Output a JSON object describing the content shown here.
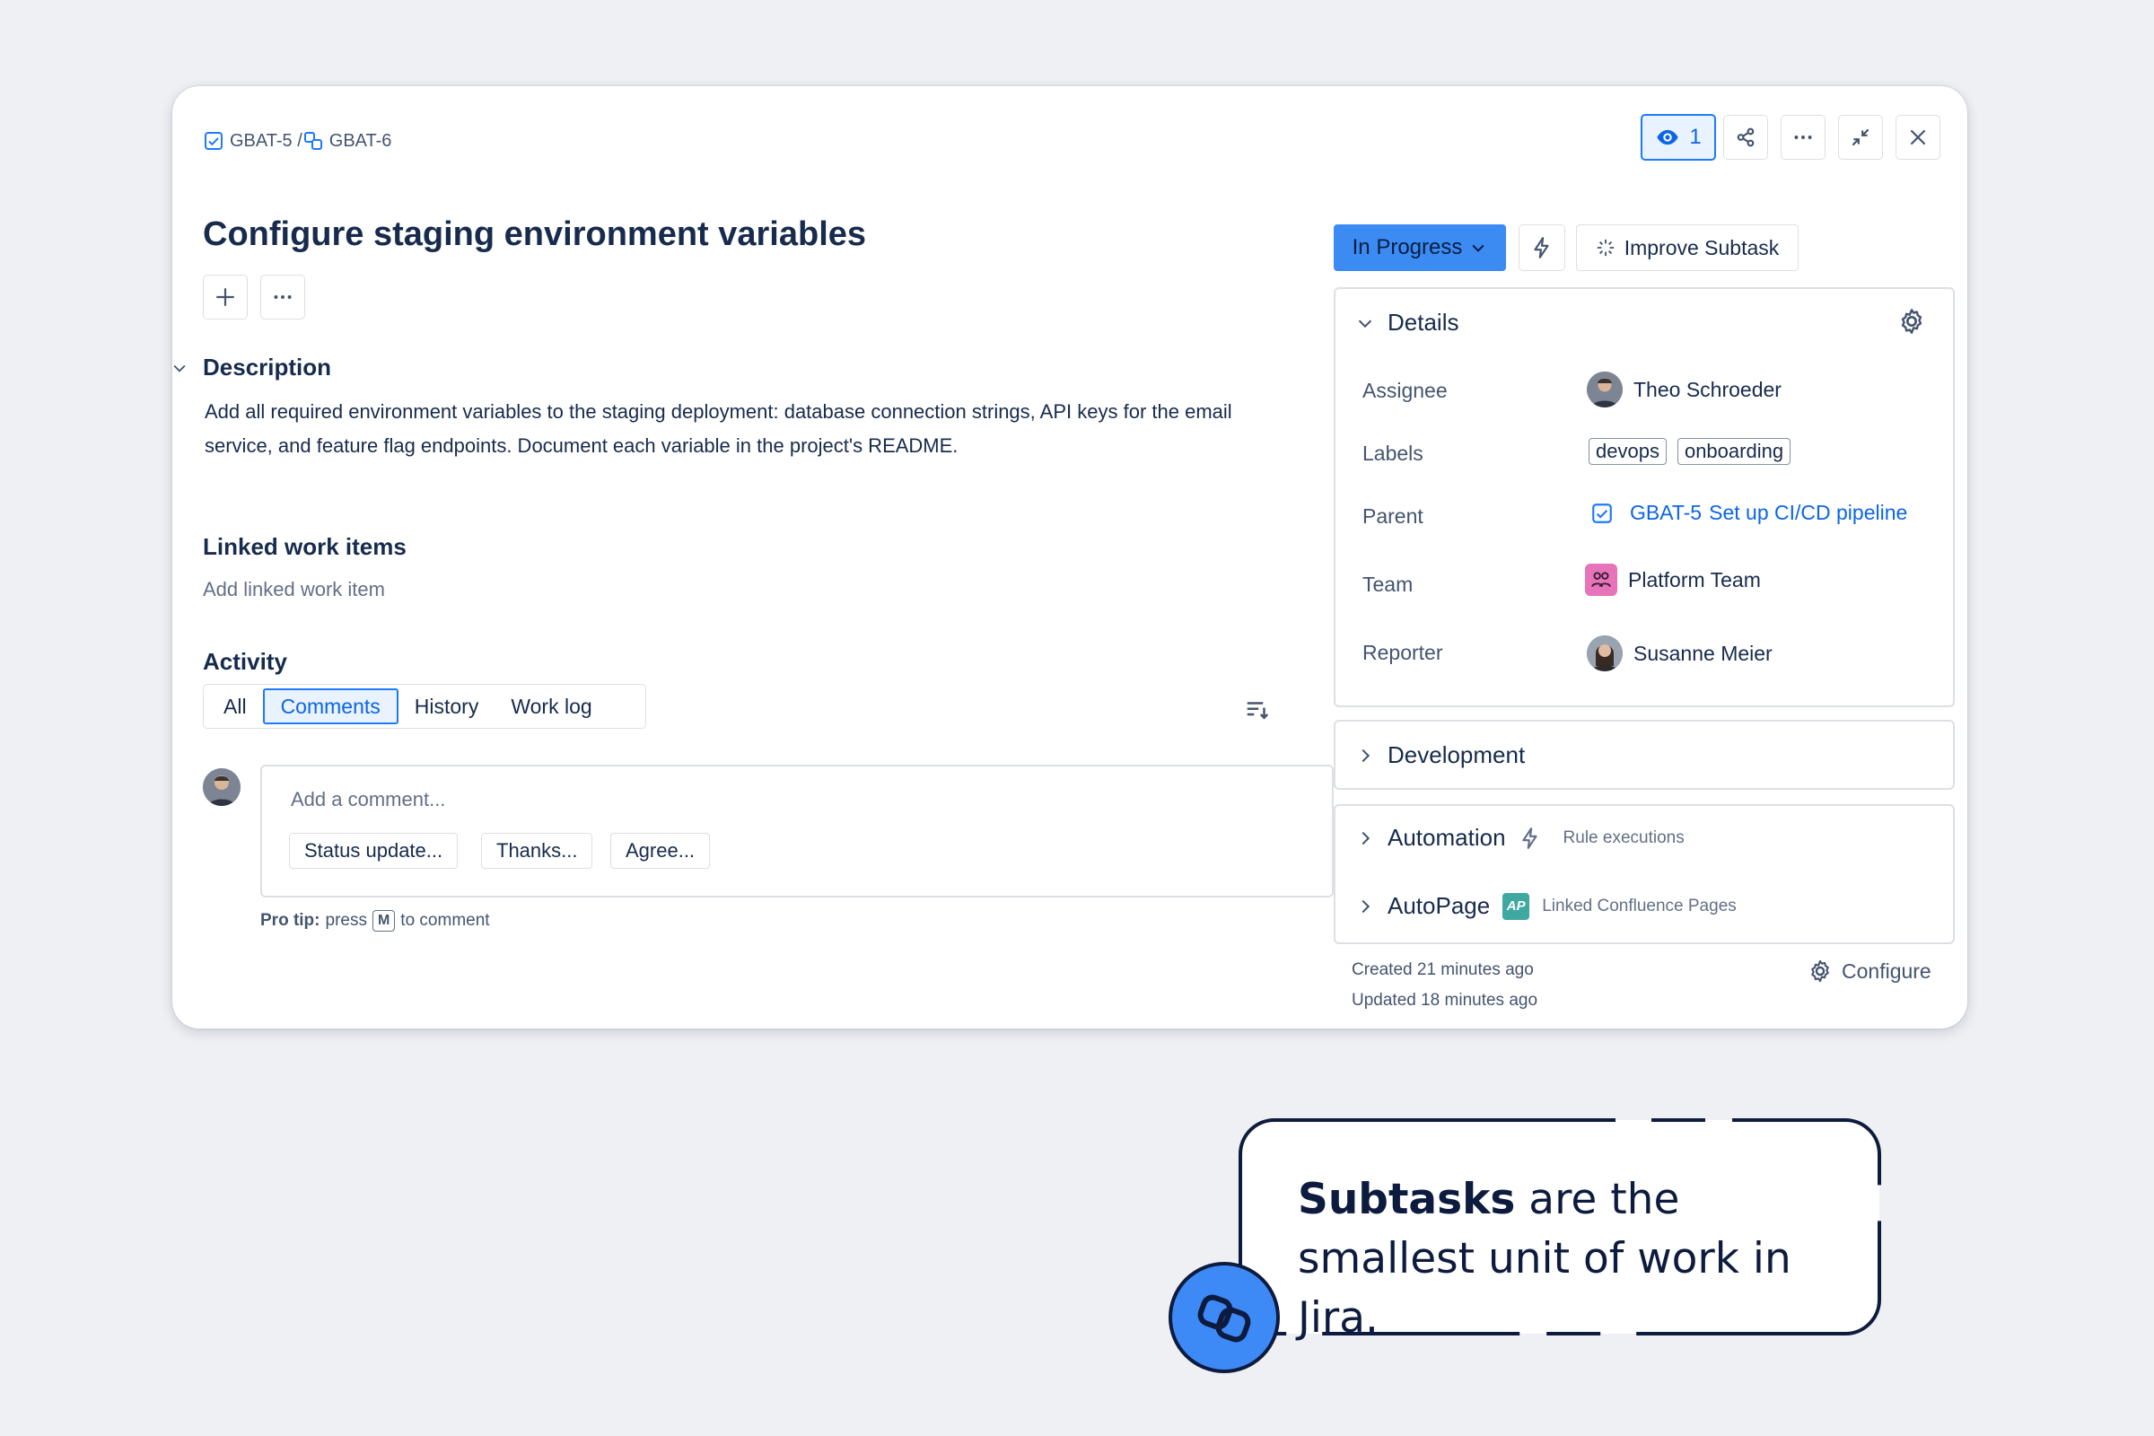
{
  "breadcrumb": {
    "parent": "GBAT-5 /",
    "current": "GBAT-6"
  },
  "toolbar": {
    "watch_count": "1"
  },
  "issue": {
    "title": "Configure staging environment variables"
  },
  "description": {
    "heading": "Description",
    "text": "Add all required environment variables to the staging deployment: database connection strings, API keys for the email service, and feature flag endpoints. Document each variable in the project's README."
  },
  "linked": {
    "heading": "Linked work items",
    "placeholder": "Add linked work item"
  },
  "activity": {
    "heading": "Activity",
    "tabs": [
      {
        "label": "All"
      },
      {
        "label": "Comments"
      },
      {
        "label": "History"
      },
      {
        "label": "Work log"
      }
    ],
    "comment_placeholder": "Add a comment...",
    "quick_replies": [
      "Status update...",
      "Thanks...",
      "Agree..."
    ],
    "protip_bold": "Pro tip:",
    "protip_press": "press",
    "protip_key": "M",
    "protip_suffix": "to comment"
  },
  "status": {
    "label": "In Progress"
  },
  "improve": {
    "label": "Improve Subtask"
  },
  "details": {
    "heading": "Details",
    "fields": {
      "assignee": {
        "label": "Assignee",
        "value": "Theo Schroeder"
      },
      "labels": {
        "label": "Labels",
        "values": [
          "devops",
          "onboarding"
        ]
      },
      "parent": {
        "label": "Parent",
        "key": "GBAT-5",
        "summary": "Set up CI/CD pipeline"
      },
      "team": {
        "label": "Team",
        "value": "Platform Team"
      },
      "reporter": {
        "label": "Reporter",
        "value": "Susanne Meier"
      }
    }
  },
  "development": {
    "heading": "Development"
  },
  "automation": {
    "heading": "Automation",
    "sub": "Rule executions"
  },
  "autopage": {
    "heading": "AutoPage",
    "sub": "Linked Confluence Pages",
    "badge": "AP"
  },
  "meta": {
    "created": "Created 21 minutes ago",
    "updated": "Updated 18 minutes ago",
    "configure": "Configure"
  },
  "callout": {
    "bold": "Subtasks",
    "rest": " are the smallest unit of work in Jira."
  },
  "colors": {
    "accent": "#1d7afc",
    "status_bg": "#3b8bf3",
    "team": "#e774bb",
    "callout_logo": "#3d8af7"
  }
}
